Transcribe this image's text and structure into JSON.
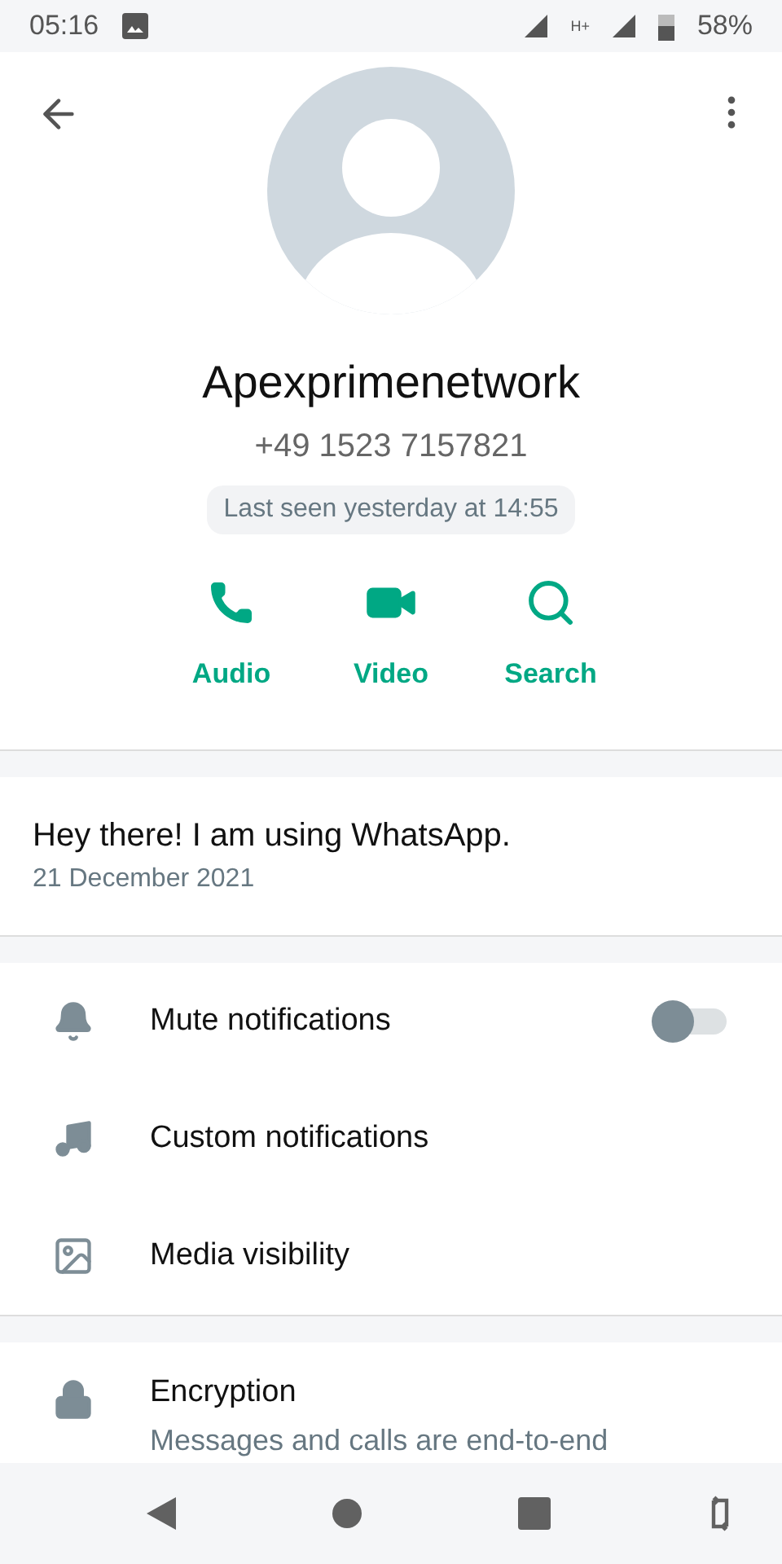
{
  "status_bar": {
    "time": "05:16",
    "network": "H+",
    "battery": "58%"
  },
  "profile": {
    "name": "Apexprimenetwork",
    "phone": "+49 1523 7157821",
    "last_seen": "Last seen yesterday at 14:55"
  },
  "actions": [
    {
      "kind": "audio",
      "label": "Audio"
    },
    {
      "kind": "video",
      "label": "Video"
    },
    {
      "kind": "search",
      "label": "Search"
    }
  ],
  "about": {
    "text": "Hey there! I am using WhatsApp.",
    "date": "21 December 2021"
  },
  "settings": [
    {
      "kind": "mute",
      "label": "Mute notifications",
      "on": false
    },
    {
      "kind": "custom",
      "label": "Custom notifications"
    },
    {
      "kind": "media",
      "label": "Media visibility"
    }
  ],
  "encryption": {
    "title": "Encryption",
    "text": "Messages and calls are end-to-end"
  }
}
